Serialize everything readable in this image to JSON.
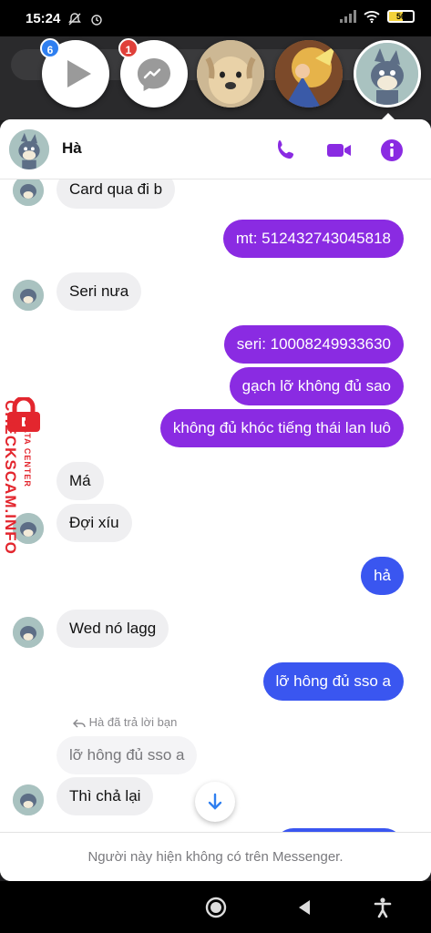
{
  "status_bar": {
    "time": "15:24",
    "battery": "56"
  },
  "chat_heads": {
    "play_badge": "6",
    "messenger_badge": "1"
  },
  "header": {
    "name": "Hà"
  },
  "messages": [
    {
      "from": "them",
      "text": "Card qua đi b"
    },
    {
      "from": "me",
      "text": "mt: 512432743045818"
    },
    {
      "from": "them",
      "text": "Seri nưa"
    },
    {
      "from": "me",
      "text": "seri: 10008249933630"
    },
    {
      "from": "me",
      "text": "gạch lỡ không đủ sao"
    },
    {
      "from": "me",
      "text": "không đủ khóc tiếng thái lan luô"
    },
    {
      "from": "them",
      "text": "Má"
    },
    {
      "from": "them",
      "text": "Đợi xíu"
    },
    {
      "from": "me",
      "text": "hả"
    },
    {
      "from": "them",
      "text": "Wed nó lagg"
    },
    {
      "from": "me",
      "text": "lỡ hông đủ sso a"
    }
  ],
  "reply": {
    "label": "Hà đã trả lời bạn",
    "quoted": "lỡ hông đủ sso a",
    "text": "Thì chả lại"
  },
  "footer_note": "Người này hiện không có trên Messenger.",
  "watermark": {
    "main": "CHECKSCAM.INFO",
    "sub": "DATA CENTER"
  },
  "colors": {
    "accent": "#8a2be2",
    "blue": "#3a56f0",
    "incoming": "#efeff1"
  }
}
